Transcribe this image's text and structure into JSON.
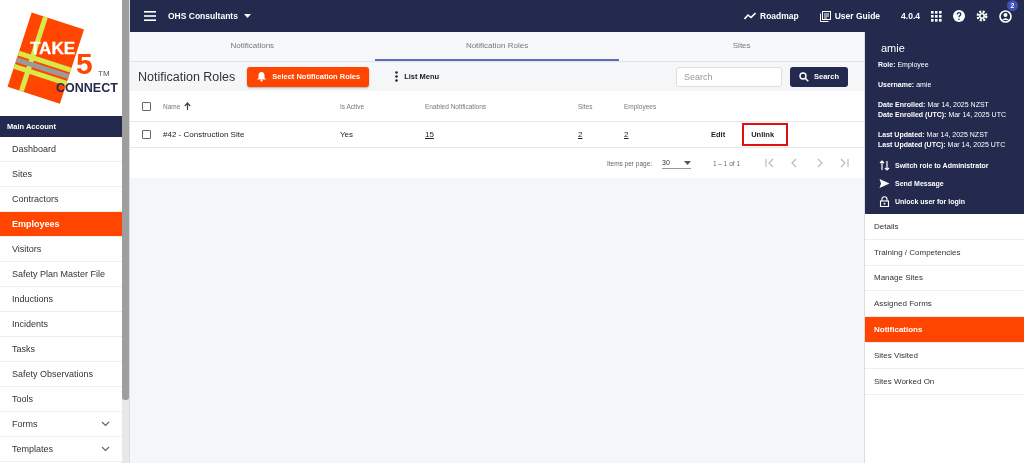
{
  "logo": {
    "word_1": "TAKE",
    "word_2": "5",
    "word_3": "CONNECT",
    "trademark": "TM"
  },
  "sidebar": {
    "header": "Main Account",
    "items": [
      {
        "label": "Dashboard",
        "kind": "link",
        "selected": false
      },
      {
        "label": "Sites",
        "kind": "link",
        "selected": false
      },
      {
        "label": "Contractors",
        "kind": "link",
        "selected": false
      },
      {
        "label": "Employees",
        "kind": "link",
        "selected": true
      },
      {
        "label": "Visitors",
        "kind": "link",
        "selected": false
      },
      {
        "label": "Safety Plan Master File",
        "kind": "link",
        "selected": false
      },
      {
        "label": "Inductions",
        "kind": "link",
        "selected": false
      },
      {
        "label": "Incidents",
        "kind": "link",
        "selected": false
      },
      {
        "label": "Tasks",
        "kind": "link",
        "selected": false
      },
      {
        "label": "Safety Observations",
        "kind": "link",
        "selected": false
      },
      {
        "label": "Tools",
        "kind": "link",
        "selected": false
      },
      {
        "label": "Forms",
        "kind": "group",
        "selected": false
      },
      {
        "label": "Templates",
        "kind": "group",
        "selected": false
      }
    ]
  },
  "topbar": {
    "organization": "OHS Consultants",
    "links": [
      {
        "label": "Roadmap",
        "kind": "roadmap"
      },
      {
        "label": "User Guide",
        "kind": "guide"
      }
    ],
    "version": "4.0.4",
    "notification_count": "2"
  },
  "tabs": [
    {
      "label": "Notifications",
      "selected": false
    },
    {
      "label": "Notification Roles",
      "selected": true
    },
    {
      "label": "Sites",
      "selected": false
    }
  ],
  "toolbar": {
    "title": "Notification Roles",
    "primary_button": "Select Notification Roles",
    "menu_button": "List Menu",
    "search": {
      "placeholder": "Search"
    },
    "search_button": "Search"
  },
  "table": {
    "all_checked": false,
    "columns": [
      {
        "label": "Name",
        "sorted": true
      },
      {
        "label": "Is Active",
        "sorted": false
      },
      {
        "label": "Enabled Notifications",
        "sorted": false
      },
      {
        "label": "Sites",
        "sorted": false
      },
      {
        "label": "Employees",
        "sorted": false
      }
    ],
    "rows": [
      {
        "checked": false,
        "cells": [
          {
            "text": "#42 - Construction Site",
            "link": false
          },
          {
            "text": "Yes",
            "link": false
          },
          {
            "text": "15",
            "link": true
          },
          {
            "text": "2",
            "link": true
          },
          {
            "text": "2",
            "link": true
          }
        ],
        "actions": [
          {
            "label": "Edit",
            "highlighted": false
          },
          {
            "label": "Unlink",
            "highlighted": true
          }
        ]
      }
    ]
  },
  "paginator": {
    "label": "Items per page:",
    "page_size": "30",
    "range": "1 – 1 of 1"
  },
  "user_panel": {
    "name": "amie",
    "info_groups": [
      [
        {
          "label": "Role:",
          "value": "Employee"
        }
      ],
      [
        {
          "label": "Username:",
          "value": "amie"
        }
      ],
      [
        {
          "label": "Date Enrolled:",
          "value": "Mar 14, 2025 NZST"
        },
        {
          "label": "Date Enrolled (UTC):",
          "value": "Mar 14, 2025 UTC"
        }
      ],
      [
        {
          "label": "Last Updated:",
          "value": "Mar 14, 2025 NZST"
        },
        {
          "label": "Last Updated (UTC):",
          "value": "Mar 14, 2025 UTC"
        }
      ]
    ],
    "actions": [
      {
        "label": "Switch role to Administrator",
        "kind": "switch"
      },
      {
        "label": "Send Message",
        "kind": "send"
      },
      {
        "label": "Unlock user for login",
        "kind": "unlock"
      }
    ],
    "menu": [
      {
        "label": "Details",
        "selected": false
      },
      {
        "label": "Training / Competencies",
        "selected": false
      },
      {
        "label": "Manage Sites",
        "selected": false
      },
      {
        "label": "Assigned Forms",
        "selected": false
      },
      {
        "label": "Notifications",
        "selected": true
      },
      {
        "label": "Sites Visited",
        "selected": false
      },
      {
        "label": "Sites Worked On",
        "selected": false
      }
    ]
  }
}
